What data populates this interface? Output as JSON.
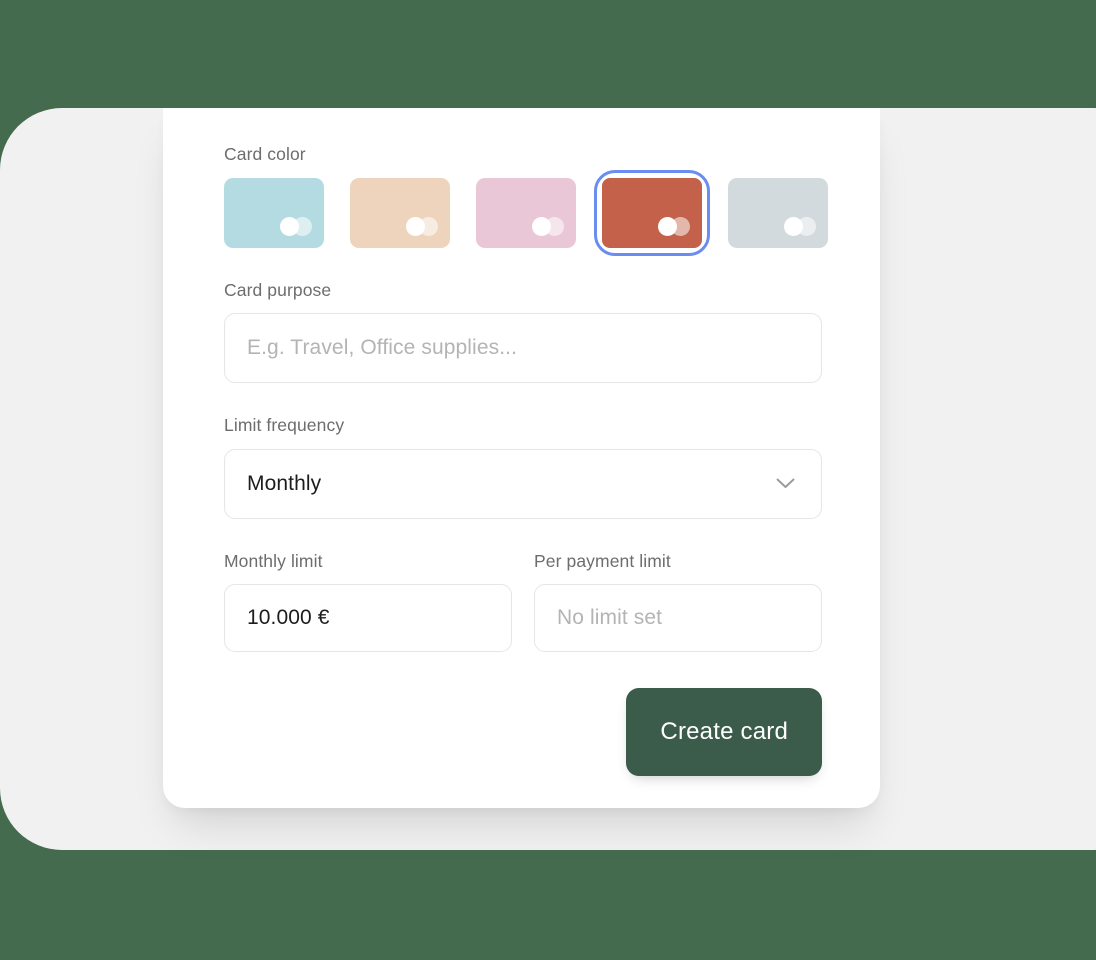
{
  "theme": {
    "page_background": "#456b4e",
    "panel_background": "#f1f1f1",
    "card_background": "#ffffff",
    "label_color": "#6d6d6d",
    "value_color": "#1d1d1d",
    "placeholder_color": "#b4b4b4",
    "input_border": "#e6e6e6",
    "focus_ring": "#6b8cf0",
    "primary_button": "#3c5c4b"
  },
  "form": {
    "card_color": {
      "label": "Card color",
      "swatches": [
        {
          "name": "light-blue",
          "color": "#b5dbe2",
          "selected": false
        },
        {
          "name": "peach",
          "color": "#eed4bd",
          "selected": false
        },
        {
          "name": "pink",
          "color": "#e9c7d7",
          "selected": false
        },
        {
          "name": "terracotta",
          "color": "#c4614b",
          "selected": true
        },
        {
          "name": "slate-grey",
          "color": "#d2dade",
          "selected": false
        }
      ]
    },
    "card_purpose": {
      "label": "Card purpose",
      "value": "",
      "placeholder": "E.g. Travel, Office supplies..."
    },
    "limit_frequency": {
      "label": "Limit frequency",
      "value": "Monthly",
      "icon": "chevron-down-icon",
      "options": [
        "Monthly"
      ]
    },
    "monthly_limit": {
      "label": "Monthly limit",
      "value": "10.000 €",
      "placeholder": ""
    },
    "per_payment_limit": {
      "label": "Per payment limit",
      "value": "",
      "placeholder": "No limit set"
    },
    "submit": {
      "label": "Create card"
    }
  }
}
